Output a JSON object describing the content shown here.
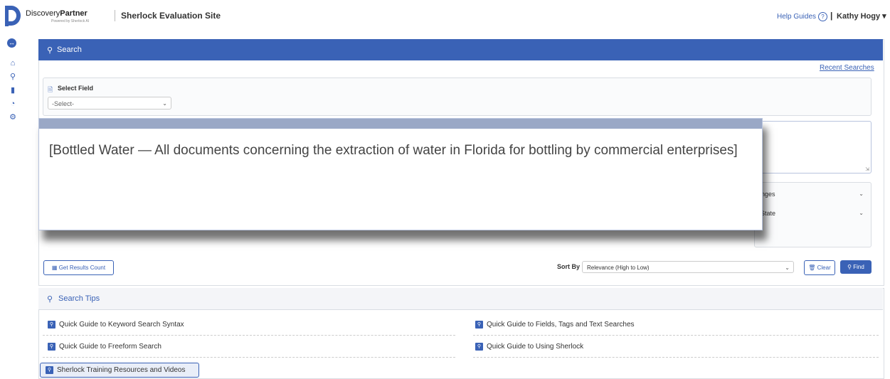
{
  "brand": {
    "name_regular": "Discovery",
    "name_bold": "Partner",
    "tagline": "Powered by Sherlock AI"
  },
  "header": {
    "site_title": "Sherlock Evaluation Site",
    "help_label": "Help Guides",
    "user_name": "Kathy Hogy ▾"
  },
  "nav": {
    "icons": [
      "nav-toggle-icon",
      "home-icon",
      "search-icon",
      "folder-icon",
      "chart-icon",
      "gear-icon"
    ]
  },
  "search": {
    "title": "Search",
    "recent_link": "Recent Searches",
    "select_field_label": "Select Field",
    "select_value": "-Select-",
    "filter1_value": "hanges",
    "filter2_value": "w State",
    "overlay_text": "[Bottled Water — All documents concerning the extraction of water in Florida for bottling by commercial enterprises]",
    "results_btn": "Get Results Count",
    "sort_label": "Sort By",
    "sort_value": "Relevance (High to Low)",
    "clear_btn": "Clear",
    "find_btn": "Find"
  },
  "tips": {
    "title": "Search Tips",
    "items": [
      "Quick Guide to Keyword Search Syntax",
      "Quick Guide to Fields, Tags and Text Searches",
      "Quick Guide to Freeform Search",
      "Quick Guide to Using Sherlock"
    ],
    "training": "Sherlock Training Resources and Videos"
  },
  "colors": {
    "accent": "#3a62b6"
  }
}
